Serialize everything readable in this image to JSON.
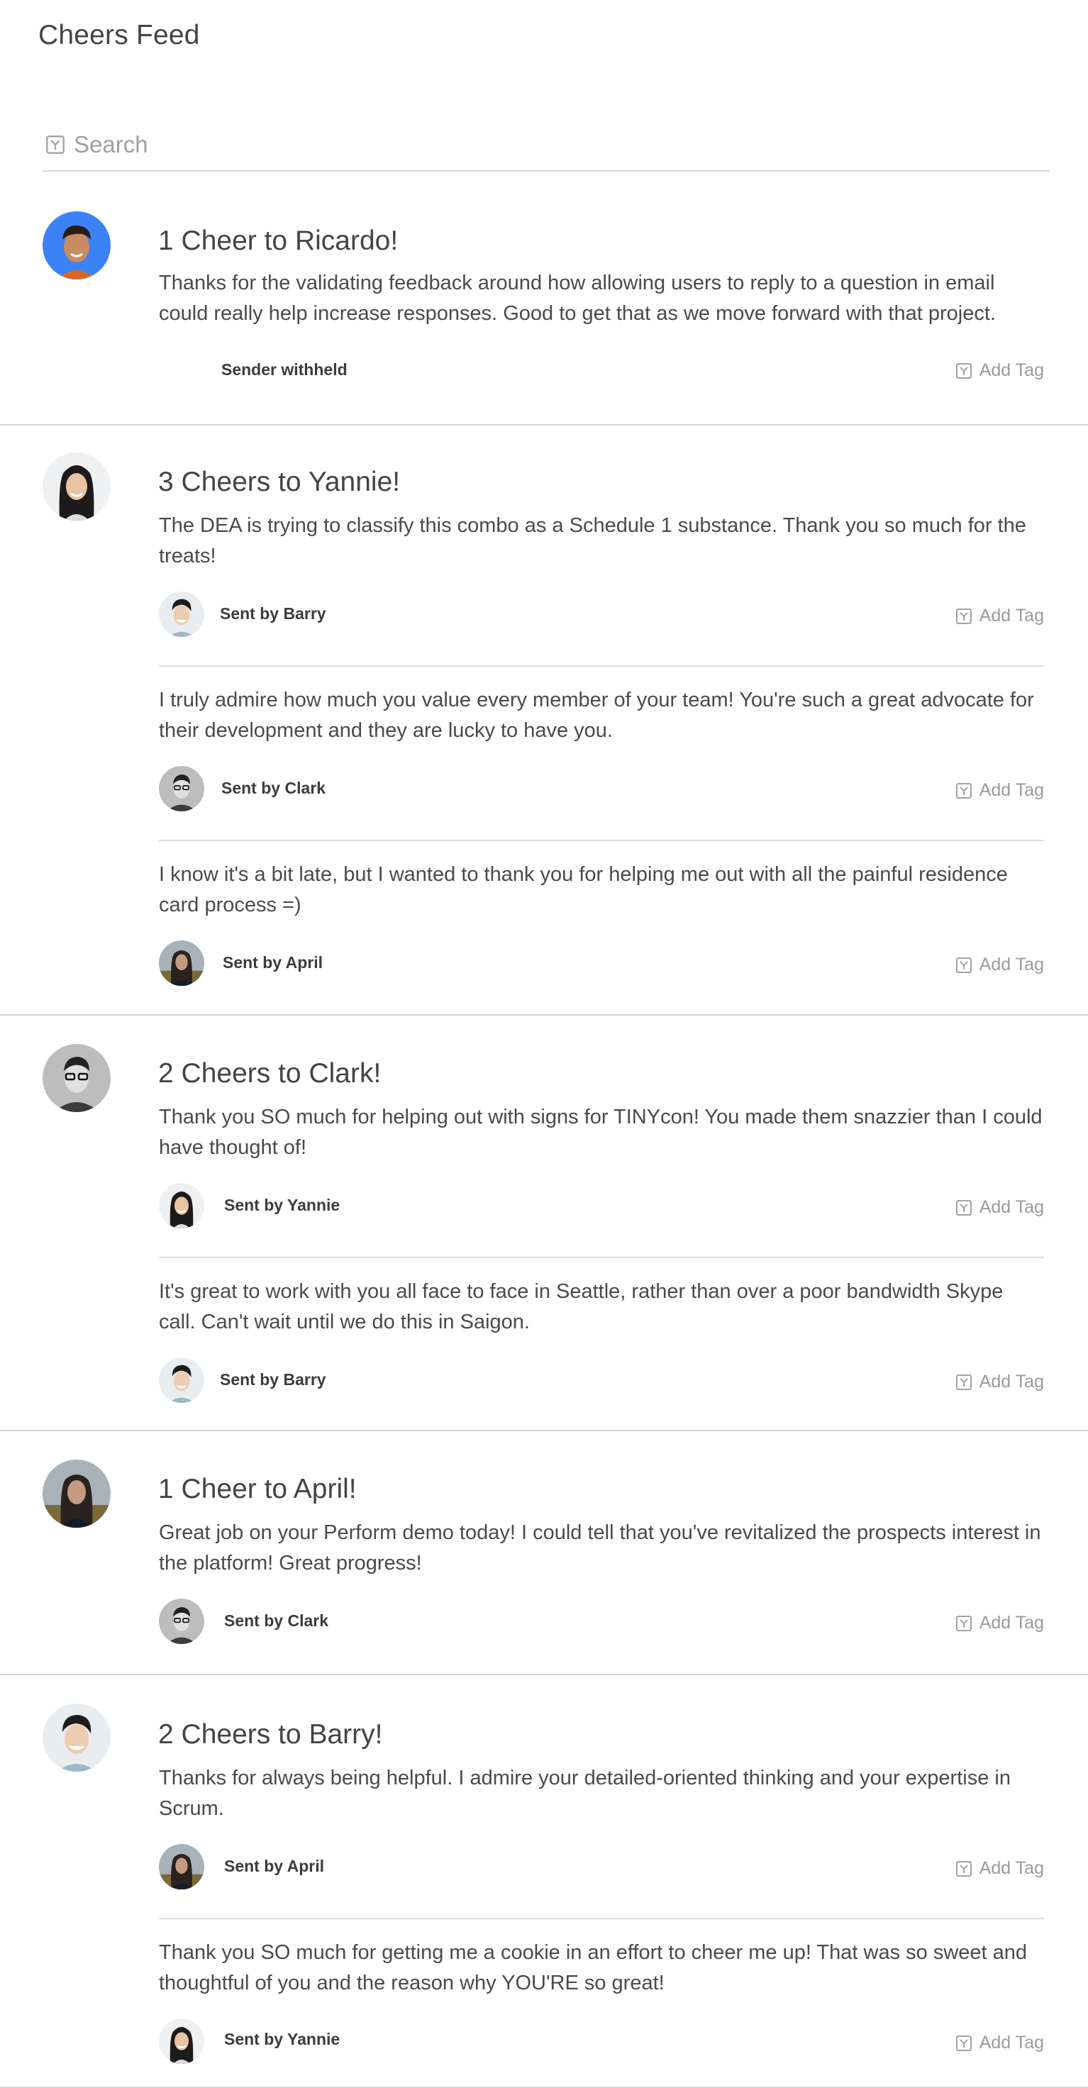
{
  "header": {
    "title": "Cheers Feed"
  },
  "search": {
    "placeholder": "Search",
    "icon": "search-icon"
  },
  "add_tag_label": "Add Tag",
  "colors": {
    "accent_blue": "#3b82f6",
    "divider": "#d6d6d6",
    "text": "#444444",
    "muted": "#9b9b9b"
  },
  "groups": [
    {
      "title": "1 Cheer to Ricardo!",
      "recipient": "Ricardo",
      "cheers": [
        {
          "message": "Thanks for the validating feedback around how allowing users to reply to a question in email could really help increase responses. Good to get that as we move forward with that project.",
          "sender": "Sender withheld"
        }
      ]
    },
    {
      "title": "3 Cheers to Yannie!",
      "recipient": "Yannie",
      "cheers": [
        {
          "message": "The DEA is trying to classify this combo as a  Schedule 1 substance. Thank you so much for the treats!",
          "sender": "Sent by Barry"
        },
        {
          "message": "I truly admire how much you value every member of your team! You're such a great advocate for their development and they are lucky to have you.",
          "sender": "Sent by Clark"
        },
        {
          "message": "I know it's a bit late, but I wanted to thank you for helping me out with all the painful residence card process =)",
          "sender": "Sent by April"
        }
      ]
    },
    {
      "title": "2 Cheers to Clark!",
      "recipient": "Clark",
      "cheers": [
        {
          "message": "Thank you SO much for helping out with signs for TINYcon! You made them snazzier than I could have thought of!",
          "sender": "Sent by Yannie"
        },
        {
          "message": "It's great to work with you all face to face in Seattle, rather than over a poor bandwidth Skype call. Can't wait until we do this in Saigon.",
          "sender": "Sent by Barry"
        }
      ]
    },
    {
      "title": "1 Cheer to April!",
      "recipient": "April",
      "cheers": [
        {
          "message": "Great job on your Perform demo today!  I could tell that you've revitalized the prospects interest in the platform!  Great progress!",
          "sender": "Sent by Clark"
        }
      ]
    },
    {
      "title": "2 Cheers to Barry!",
      "recipient": "Barry",
      "cheers": [
        {
          "message": "Thanks for always being helpful. I admire your detailed-oriented thinking and your expertise in Scrum.",
          "sender": "Sent by April"
        },
        {
          "message": "Thank you SO much for getting me a cookie in an effort to cheer me up! That was so sweet and thoughtful of you and the reason why YOU'RE so great!",
          "sender": "Sent by Yannie"
        }
      ]
    }
  ]
}
